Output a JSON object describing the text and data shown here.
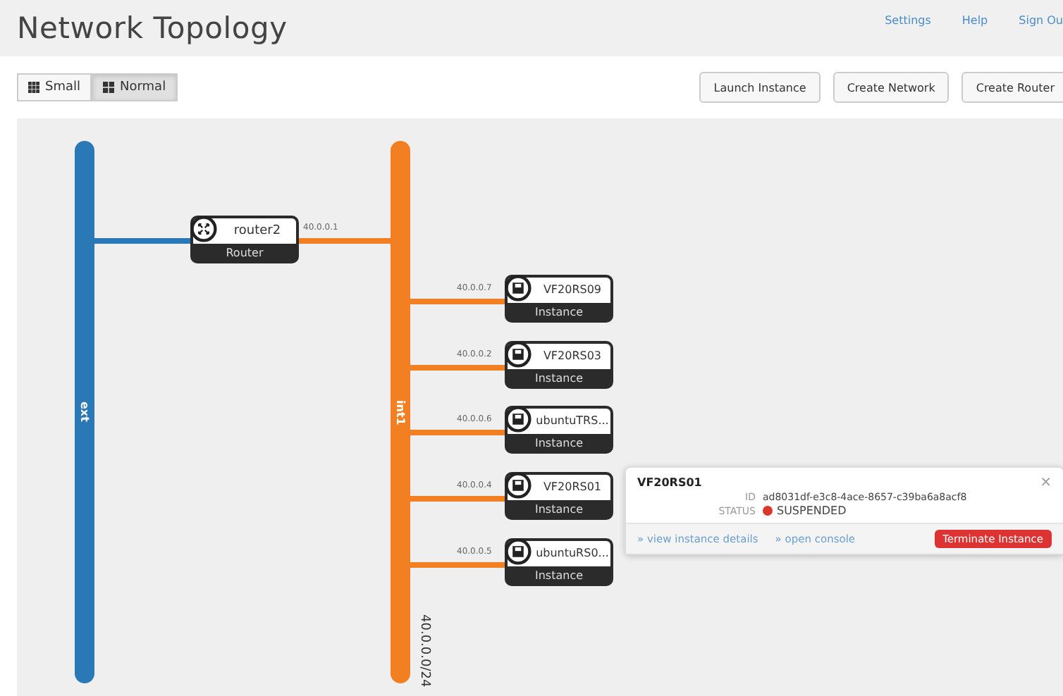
{
  "header": {
    "title": "Network Topology",
    "links": [
      "Settings",
      "Help",
      "Sign Ou"
    ]
  },
  "view_toggle": [
    {
      "label": "Small",
      "selected": false
    },
    {
      "label": "Normal",
      "selected": true
    }
  ],
  "actions": [
    "Launch Instance",
    "Create Network",
    "Create Router"
  ],
  "networks": [
    {
      "name": "ext",
      "color": "#2a78b5"
    },
    {
      "name": "int1",
      "color": "#f28022",
      "cidr": "40.0.0.0/24"
    }
  ],
  "routers": [
    {
      "name": "router2",
      "type": "Router",
      "ip": "40.0.0.1"
    }
  ],
  "instances": [
    {
      "name": "VF20RS09",
      "type": "Instance",
      "ip": "40.0.0.7"
    },
    {
      "name": "VF20RS03",
      "type": "Instance",
      "ip": "40.0.0.2"
    },
    {
      "name": "ubuntuTRS...",
      "type": "Instance",
      "ip": "40.0.0.6"
    },
    {
      "name": "VF20RS01",
      "type": "Instance",
      "ip": "40.0.0.4"
    },
    {
      "name": "ubuntuRS0...",
      "type": "Instance",
      "ip": "40.0.0.5"
    }
  ],
  "popup": {
    "title": "VF20RS01",
    "close": "×",
    "id_label": "ID",
    "id": "ad8031df-e3c8-4ace-8657-c39ba6a8acf8",
    "status_label": "STATUS",
    "status": "SUSPENDED",
    "links": [
      "» view instance details",
      "» open console"
    ],
    "button": "Terminate Instance"
  }
}
